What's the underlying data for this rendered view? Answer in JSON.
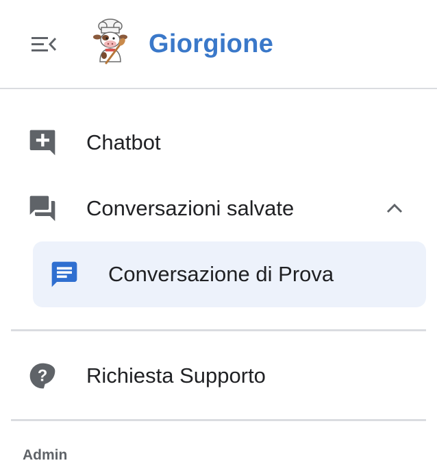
{
  "app": {
    "title": "Giorgione",
    "accent_color": "#3a78c9",
    "logo_icon": "chef-cow-logo"
  },
  "header": {
    "menu_toggle_icon": "menu-collapse-icon"
  },
  "nav": {
    "chatbot": {
      "label": "Chatbot",
      "icon": "add-comment-icon"
    },
    "saved": {
      "label": "Conversazioni salvate",
      "icon": "forum-icon",
      "expanded": true,
      "items": [
        {
          "label": "Conversazione di Prova",
          "icon": "chat-icon",
          "selected": true
        }
      ]
    },
    "support": {
      "label": "Richiesta Supporto",
      "icon": "help-icon"
    }
  },
  "sections": {
    "admin": "Admin"
  }
}
